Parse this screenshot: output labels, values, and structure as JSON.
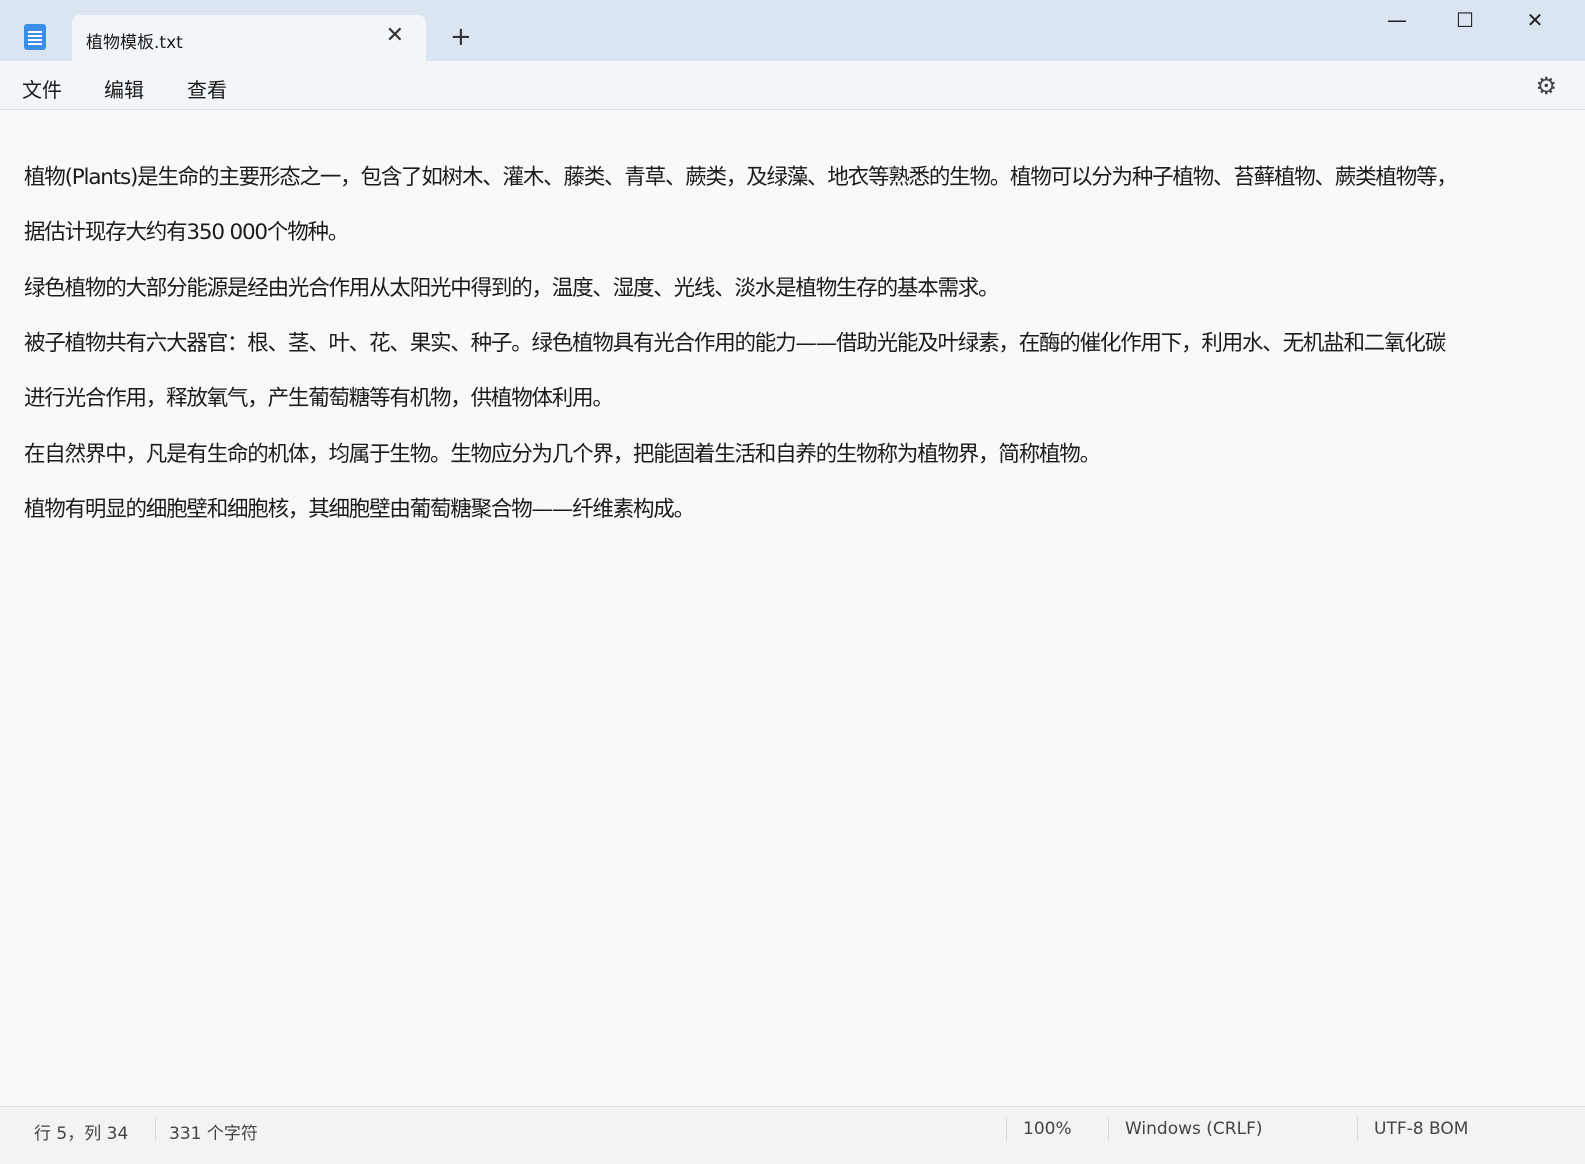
{
  "tab": {
    "title": "植物模板.txt"
  },
  "menu": {
    "file": "文件",
    "edit": "编辑",
    "view": "查看"
  },
  "window": {
    "minimize": "—",
    "maximize": "☐",
    "close": "✕",
    "new_tab": "+",
    "tab_close": "✕",
    "settings": "⚙"
  },
  "content": {
    "lines": [
      "植物(Plants)是生命的主要形态之一，包含了如树木、灌木、藤类、青草、蕨类，及绿藻、地衣等熟悉的生物。植物可以分为种子植物、苔藓植物、蕨类植物等，",
      "据估计现存大约有350 000个物种。",
      "绿色植物的大部分能源是经由光合作用从太阳光中得到的，温度、湿度、光线、淡水是植物生存的基本需求。",
      "被子植物共有六大器官：根、茎、叶、花、果实、种子。绿色植物具有光合作用的能力——借助光能及叶绿素，在酶的催化作用下，利用水、无机盐和二氧化碳",
      "进行光合作用，释放氧气，产生葡萄糖等有机物，供植物体利用。",
      "在自然界中，凡是有生命的机体，均属于生物。生物应分为几个界，把能固着生活和自养的生物称为植物界，简称植物。",
      "植物有明显的细胞壁和细胞核，其细胞壁由葡萄糖聚合物——纤维素构成。"
    ]
  },
  "status": {
    "position": "行 5，列 34",
    "chars": "331 个字符",
    "zoom": "100%",
    "line_ending": "Windows (CRLF)",
    "encoding": "UTF-8 BOM"
  }
}
